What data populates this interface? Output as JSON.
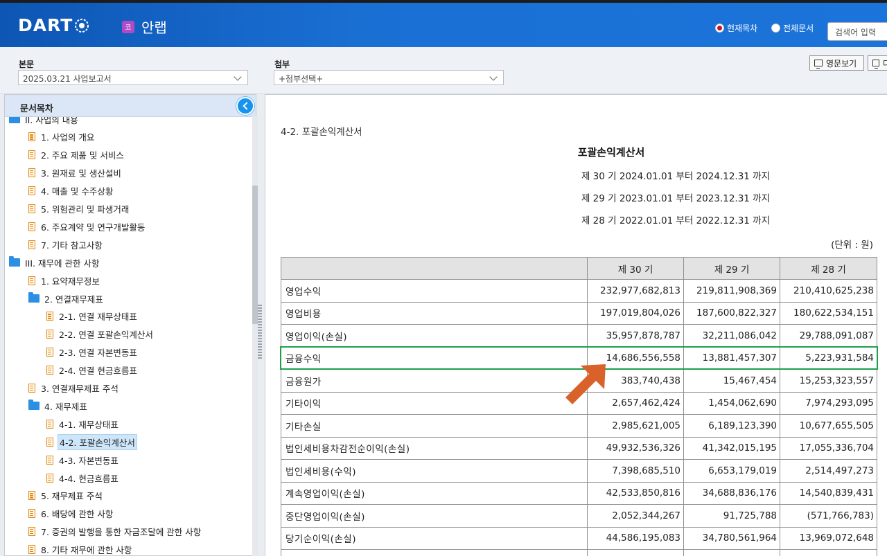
{
  "header": {
    "logo": "DART",
    "company_badge": "코",
    "company_name": "안랩",
    "radio_current": "현재목차",
    "radio_full": "전체문서",
    "search_placeholder": "검색어 입력"
  },
  "toolbar": {
    "main_label": "본문",
    "main_select": "2025.03.21   사업보고서",
    "attach_label": "첨부",
    "attach_select": "+첨부선택+",
    "english_button": "영문보기",
    "extra_button": "다"
  },
  "sidebar": {
    "title": "문서목차",
    "items": [
      {
        "label": "II. 사업의 내용",
        "type": "folder",
        "level": 0
      },
      {
        "label": "1. 사업의 개요",
        "type": "doc",
        "level": 1
      },
      {
        "label": "2. 주요 제품 및 서비스",
        "type": "doc",
        "level": 1
      },
      {
        "label": "3. 원재료 및 생산설비",
        "type": "doc",
        "level": 1
      },
      {
        "label": "4. 매출 및 수주상황",
        "type": "doc",
        "level": 1
      },
      {
        "label": "5. 위험관리 및 파생거래",
        "type": "doc",
        "level": 1
      },
      {
        "label": "6. 주요계약 및 연구개발활동",
        "type": "doc",
        "level": 1
      },
      {
        "label": "7. 기타 참고사항",
        "type": "doc",
        "level": 1
      },
      {
        "label": "III. 재무에 관한 사항",
        "type": "folder",
        "level": 0
      },
      {
        "label": "1. 요약재무정보",
        "type": "doc",
        "level": 1
      },
      {
        "label": "2. 연결재무제표",
        "type": "folder",
        "level": 1
      },
      {
        "label": "2-1. 연결 재무상태표",
        "type": "doc",
        "level": 2
      },
      {
        "label": "2-2. 연결 포괄손익계산서",
        "type": "doc",
        "level": 2
      },
      {
        "label": "2-3. 연결 자본변동표",
        "type": "doc",
        "level": 2
      },
      {
        "label": "2-4. 연결 현금흐름표",
        "type": "doc",
        "level": 2
      },
      {
        "label": "3. 연결재무제표 주석",
        "type": "doc",
        "level": 1
      },
      {
        "label": "4. 재무제표",
        "type": "folder",
        "level": 1
      },
      {
        "label": "4-1. 재무상태표",
        "type": "doc",
        "level": 2
      },
      {
        "label": "4-2. 포괄손익계산서",
        "type": "doc",
        "level": 2,
        "selected": true
      },
      {
        "label": "4-3. 자본변동표",
        "type": "doc",
        "level": 2
      },
      {
        "label": "4-4. 현금흐름표",
        "type": "doc",
        "level": 2
      },
      {
        "label": "5. 재무제표 주석",
        "type": "doc",
        "level": 1
      },
      {
        "label": "6. 배당에 관한 사항",
        "type": "doc",
        "level": 1
      },
      {
        "label": "7. 증권의 발행을 통한 자금조달에 관한 사항",
        "type": "doc",
        "level": 1
      },
      {
        "label": "8. 기타 재무에 관한 사항",
        "type": "doc",
        "level": 1
      }
    ]
  },
  "content": {
    "section_title": "4-2. 포괄손익계산서",
    "title": "포괄손익계산서",
    "periods": [
      "제 30 기 2024.01.01 부터 2024.12.31 까지",
      "제 29 기 2023.01.01 부터 2023.12.31 까지",
      "제 28 기 2022.01.01 부터 2022.12.31 까지"
    ],
    "unit": "(단위 : 원)",
    "table": {
      "headers": [
        "",
        "제 30 기",
        "제 29 기",
        "제 28 기"
      ],
      "rows": [
        [
          "영업수익",
          "232,977,682,813",
          "219,811,908,369",
          "210,410,625,238"
        ],
        [
          "영업비용",
          "197,019,804,026",
          "187,600,822,327",
          "180,622,534,151"
        ],
        [
          "영업이익(손실)",
          "35,957,878,787",
          "32,211,086,042",
          "29,788,091,087"
        ],
        [
          "금융수익",
          "14,686,556,558",
          "13,881,457,307",
          "5,223,931,584"
        ],
        [
          "금융원가",
          "383,740,438",
          "15,467,454",
          "15,253,323,557"
        ],
        [
          "기타이익",
          "2,657,462,424",
          "1,454,062,690",
          "7,974,293,095"
        ],
        [
          "기타손실",
          "2,985,621,005",
          "6,189,123,390",
          "10,677,655,505"
        ],
        [
          "법인세비용차감전순이익(손실)",
          "49,932,536,326",
          "41,342,015,195",
          "17,055,336,704"
        ],
        [
          "법인세비용(수익)",
          "7,398,685,510",
          "6,653,179,019",
          "2,514,497,273"
        ],
        [
          "계속영업이익(손실)",
          "42,533,850,816",
          "34,688,836,176",
          "14,540,839,431"
        ],
        [
          "중단영업이익(손실)",
          "2,052,344,267",
          "91,725,788",
          "(571,766,783)"
        ],
        [
          "당기순이익(손실)",
          "44,586,195,083",
          "34,780,561,964",
          "13,969,072,648"
        ],
        [
          "",
          "",
          "",
          ""
        ]
      ]
    },
    "highlighted_row": "금융수익",
    "annotation_color": "#1ea04a",
    "arrow_color": "#d9622b"
  }
}
